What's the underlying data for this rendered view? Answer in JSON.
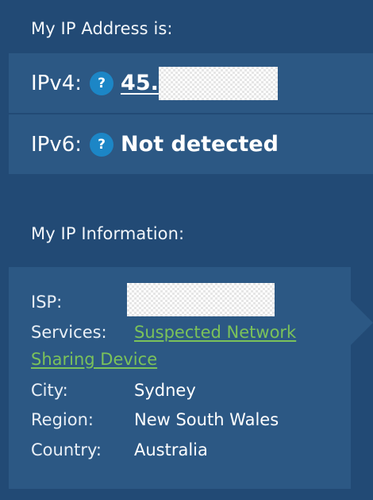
{
  "header": {
    "address_heading": "My IP Address is:",
    "info_heading": "My IP Information:"
  },
  "ipv4": {
    "label": "IPv4:",
    "help": "?",
    "value": "45."
  },
  "ipv6": {
    "label": "IPv6:",
    "help": "?",
    "value": "Not detected"
  },
  "info": {
    "isp_label": "ISP:",
    "services_label": "Services:",
    "services_line1": "Suspected Network",
    "services_line2": "Sharing Device",
    "city_label": "City:",
    "city_value": "Sydney",
    "region_label": "Region:",
    "region_value": "New South Wales",
    "country_label": "Country:",
    "country_value": "Australia"
  },
  "colors": {
    "background": "#224a75",
    "panel": "#2c5884",
    "help_icon": "#1c86c6",
    "link_green": "#7bc25a"
  },
  "icons": {
    "help": "question-circle-icon"
  }
}
